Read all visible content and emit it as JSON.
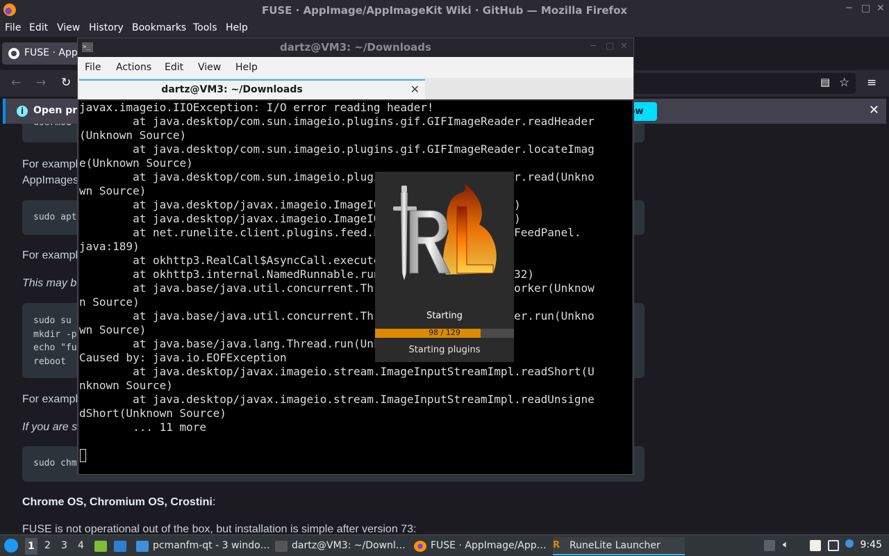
{
  "firefox": {
    "title": "FUSE · AppImage/AppImageKit Wiki · GitHub — Mozilla Firefox",
    "menu": [
      "File",
      "Edit",
      "View",
      "History",
      "Bookmarks",
      "Tools",
      "Help"
    ],
    "tab_label": "FUSE · AppI",
    "notification_text": "Open pre",
    "notification_button": "ow",
    "content": {
      "code_partial_top": "usermod",
      "para_1a": "For example",
      "para_1b": "AppImages",
      "code_1": "sudo apt",
      "para_2": "For example",
      "para_3": "This may b",
      "code_2_lines": [
        "sudo su",
        "mkdir -p",
        "echo \"fu",
        "reboot"
      ],
      "para_4": "For example",
      "para_5": "If you are s",
      "code_3": "sudo chm",
      "heading": "Chrome OS, Chromium OS, Crostini",
      "heading_suffix": ":",
      "para_6": "FUSE is not operational out of the box, but installation is simple after version 73:"
    }
  },
  "terminal": {
    "window_title": "dartz@VM3: ~/Downloads",
    "menu": [
      "File",
      "Actions",
      "Edit",
      "View",
      "Help"
    ],
    "tab_title": "dartz@VM3: ~/Downloads",
    "lines": [
      "javax.imageio.IIOException: I/O error reading header!",
      "        at java.desktop/com.sun.imageio.plugins.gif.GIFImageReader.readHeader",
      "(Unknown Source)",
      "        at java.desktop/com.sun.imageio.plugins.gif.GIFImageReader.locateImag",
      "e(Unknown Source)",
      "        at java.desktop/com.sun.imageio.plugins.gif.GIFImageReader.read(Unkno",
      "wn Source)",
      "        at java.desktop/javax.imageio.ImageIO.read(Unknown Source)",
      "        at java.desktop/javax.imageio.ImageIO.read(Unknown Source)",
      "        at net.runelite.client.plugins.feed.FeedPanel.onResponse(FeedPanel.",
      "java:189)",
      "        at okhttp3.RealCall$AsyncCall.execute(RealCall.java:174)",
      "        at okhttp3.internal.NamedRunnable.run(NamedRunnable.java:32)",
      "        at java.base/java.util.concurrent.ThreadPoolExecutor.runWorker(Unknow",
      "n Source)",
      "        at java.base/java.util.concurrent.ThreadPoolExecutor$Worker.run(Unkno",
      "wn Source)",
      "        at java.base/java.lang.Thread.run(Unknown Source)",
      "Caused by: java.io.EOFException",
      "        at java.desktop/javax.imageio.stream.ImageInputStreamImpl.readShort(U",
      "nknown Source)",
      "        at java.desktop/javax.imageio.stream.ImageInputStreamImpl.readUnsigne",
      "dShort(Unknown Source)",
      "        ... 11 more"
    ]
  },
  "runelite_splash": {
    "status": "Starting",
    "progress_text": "98 / 129",
    "progress_fraction": 0.76,
    "sub_status": "Starting plugins",
    "logo_letters": "RL"
  },
  "taskbar": {
    "workspaces": [
      "1",
      "2",
      "3",
      "4"
    ],
    "tasks": [
      {
        "label": "pcmanfm-qt - 3 windo…",
        "icon": "folder-icon"
      },
      {
        "label": "dartz@VM3: ~/Downl…",
        "icon": "terminal-icon"
      },
      {
        "label": "FUSE · AppImage/App…",
        "icon": "firefox-icon"
      },
      {
        "label": "RuneLite Launcher",
        "icon": "runelite-icon"
      }
    ],
    "clock": "9:45"
  },
  "colors": {
    "firefox_dark": "#1c1b22",
    "terminal_bg": "#000000",
    "progress": "#dc8a00",
    "accent": "#3daee9"
  }
}
